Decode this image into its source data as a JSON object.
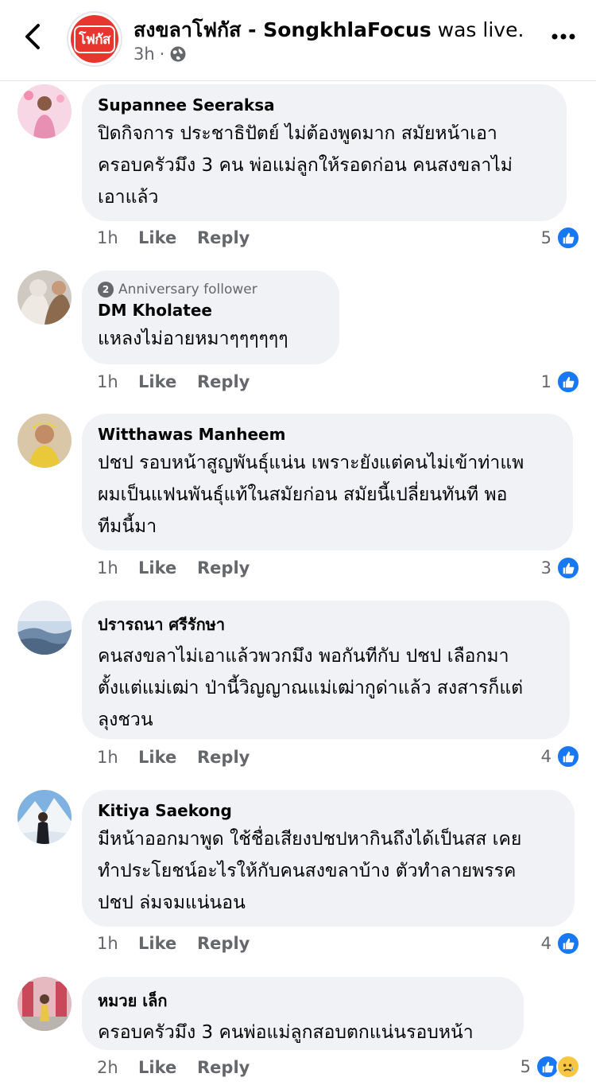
{
  "header": {
    "page_name": "สงขลาโฟกัส - SongkhlaFocus",
    "status": " was live.",
    "time": "3h",
    "separator": "·",
    "logo_text": "โฟกัส"
  },
  "comments": [
    {
      "author": "Supannee Seeraksa",
      "badge": "",
      "lines": [
        "ปิดกิจการ ประชาธิปัตย์ ไม่ต้องพูดมาก สมัยหน้าเอา",
        "ครอบครัวมึง 3 คน  พ่อแม่ลูกให้รอดก่อน คนสงขลาไม่",
        "เอาแล้ว"
      ],
      "time": "1h",
      "like": "Like",
      "reply": "Reply",
      "reactions": "5"
    },
    {
      "author": "DM Kholatee",
      "badge": "Anniversary follower",
      "badge_num": "2",
      "lines": [
        "แหลงไม่อายหมาๆๆๆๆๆๆ"
      ],
      "time": "1h",
      "like": "Like",
      "reply": "Reply",
      "reactions": "1"
    },
    {
      "author": "Witthawas Manheem",
      "badge": "",
      "lines": [
        "ปชป รอบหน้าสูญพันธุ์แน่น เพราะยังแต่คนไม่เข้าท่าแพ",
        "ผมเป็นแฟนพันธุ์แท้ในสมัยก่อน สมัยนี้เปลี่ยนทันที พอ",
        "ทีมนี้มา"
      ],
      "time": "1h",
      "like": "Like",
      "reply": "Reply",
      "reactions": "3"
    },
    {
      "author": "ปรารถนา ศรีรักษา",
      "badge": "",
      "lines": [
        "คนสงขลาไม่เอาแล้วพวกมึง พอกันทีกับ  ปชป เลือกมา",
        "ตั้งแต่แม่เฒ่า ป่านี้วิญญาณแม่เฒ่ากูด่าแล้ว สงสารก็แต่",
        "ลุงชวน"
      ],
      "time": "1h",
      "like": "Like",
      "reply": "Reply",
      "reactions": "4"
    },
    {
      "author": "Kitiya Saekong",
      "badge": "",
      "lines": [
        "มีหน้าออกมาพูด ใช้ชื่อเสียงปชปหากินถึงได้เป็นสส เคย",
        "ทำประโยชน์อะไรให้กับคนสงขลาบ้าง ตัวทำลายพรรค",
        "ปชป ล่มจมแน่นอน"
      ],
      "time": "1h",
      "like": "Like",
      "reply": "Reply",
      "reactions": "4"
    },
    {
      "author": "หมวย เล็ก",
      "badge": "",
      "lines": [
        "ครอบครัวมึง 3 คนพ่อแม่ลูกสอบตกแน่นรอบหน้า"
      ],
      "time": "2h",
      "like": "Like",
      "reply": "Reply",
      "reactions": "5"
    }
  ],
  "icons": {
    "back": "chevron-left-icon",
    "globe": "globe-icon",
    "more": "more-horizontal-icon",
    "like": "thumbs-up-icon",
    "sad": "sad-reaction-icon"
  },
  "colors": {
    "accent": "#1877f2",
    "bubble": "#f0f2f5",
    "secondary_text": "#65676b",
    "logo_red": "#e8352d"
  }
}
